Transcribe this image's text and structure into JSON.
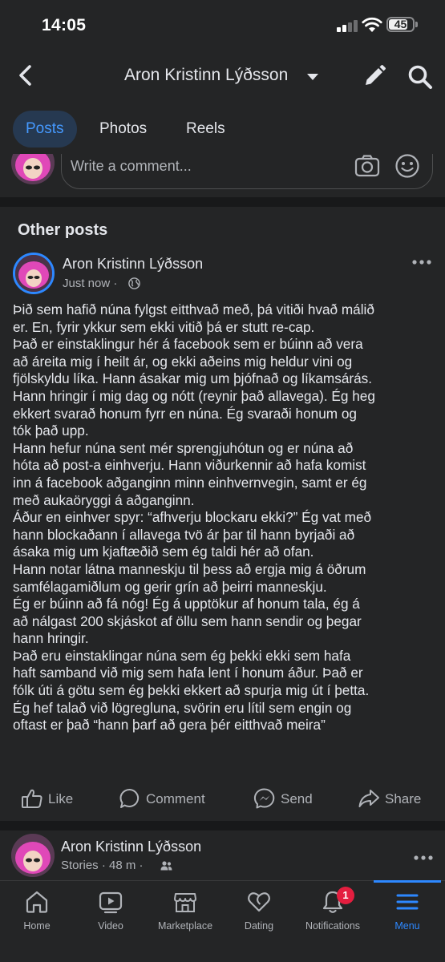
{
  "status_bar": {
    "time": "14:05",
    "battery": "45"
  },
  "header": {
    "title": "Aron Kristinn Lýðsson"
  },
  "tabs": [
    {
      "label": "Posts",
      "active": true
    },
    {
      "label": "Photos",
      "active": false
    },
    {
      "label": "Reels",
      "active": false
    }
  ],
  "comment_box": {
    "placeholder": "Write a comment..."
  },
  "section": {
    "title": "Other posts"
  },
  "post": {
    "author": "Aron Kristinn Lýðsson",
    "time": "Just now",
    "separator": "·",
    "privacy_icon": "globe-icon",
    "lines": [
      "Þið sem hafið núna fylgst eitthvað með, þá vitiði hvað málið",
      "er. En, fyrir ykkur sem ekki vitið þá er stutt re-cap.",
      "Það er einstaklingur hér á facebook sem er búinn að vera",
      "að áreita mig í heilt ár, og ekki aðeins mig heldur vini og",
      "fjölskyldu líka. Hann ásakar mig um þjófnað og líkamsárás.",
      "Hann hringir í mig dag og nótt (reynir það allavega). Ég heg",
      "ekkert svarað honum fyrr en núna. Ég svaraði honum og",
      "tók það upp.",
      "Hann hefur núna sent mér sprengjuhótun og er núna að",
      "hóta að post-a einhverju. Hann viðurkennir að hafa komist",
      "inn á facebook aðganginn minn einhvernvegin, samt er ég",
      "með aukaöryggi á aðganginn.",
      "Áður en einhver spyr: “afhverju blockaru ekki?” Ég vat með",
      "hann blockaðann í allavega tvö ár þar til hann byrjaði að",
      "ásaka mig um kjaftæðið sem ég taldi hér að ofan.",
      "Hann notar látna manneskju til þess að ergja mig á öðrum",
      "samfélagamiðlum og gerir grín að þeirri manneskju.",
      "Ég er búinn að fá nóg! Ég á upptökur af honum tala, ég á",
      "að nálgast 200 skjáskot af öllu sem hann sendir og þegar",
      "hann hringir.",
      "Það eru einstaklingar núna sem ég þekki ekki sem hafa",
      "haft samband við mig sem hafa lent í honum áður. Það er",
      "fólk úti á götu sem ég þekki ekkert að spurja mig út í þetta.",
      "Ég hef talað við lögregluna, svörin eru lítil sem engin og",
      "oftast er það “hann þarf að gera þér eitthvað meira”"
    ],
    "actions": [
      {
        "label": "Like",
        "icon": "like-icon"
      },
      {
        "label": "Comment",
        "icon": "comment-icon"
      },
      {
        "label": "Send",
        "icon": "messenger-icon"
      },
      {
        "label": "Share",
        "icon": "share-icon"
      }
    ]
  },
  "story_post": {
    "author": "Aron Kristinn Lýðsson",
    "meta": "Stories · 48 m ·",
    "audience_icon": "friends-icon"
  },
  "bottom_nav": {
    "items": [
      {
        "label": "Home",
        "icon": "home-icon"
      },
      {
        "label": "Video",
        "icon": "video-icon"
      },
      {
        "label": "Marketplace",
        "icon": "marketplace-icon"
      },
      {
        "label": "Dating",
        "icon": "dating-icon"
      },
      {
        "label": "Notifications",
        "icon": "bell-icon",
        "badge": "1"
      },
      {
        "label": "Menu",
        "icon": "menu-icon",
        "active": true
      }
    ]
  },
  "colors": {
    "accent": "#2d88ff",
    "background": "#242526",
    "divider": "#18191a",
    "badge": "#e41e3f"
  }
}
